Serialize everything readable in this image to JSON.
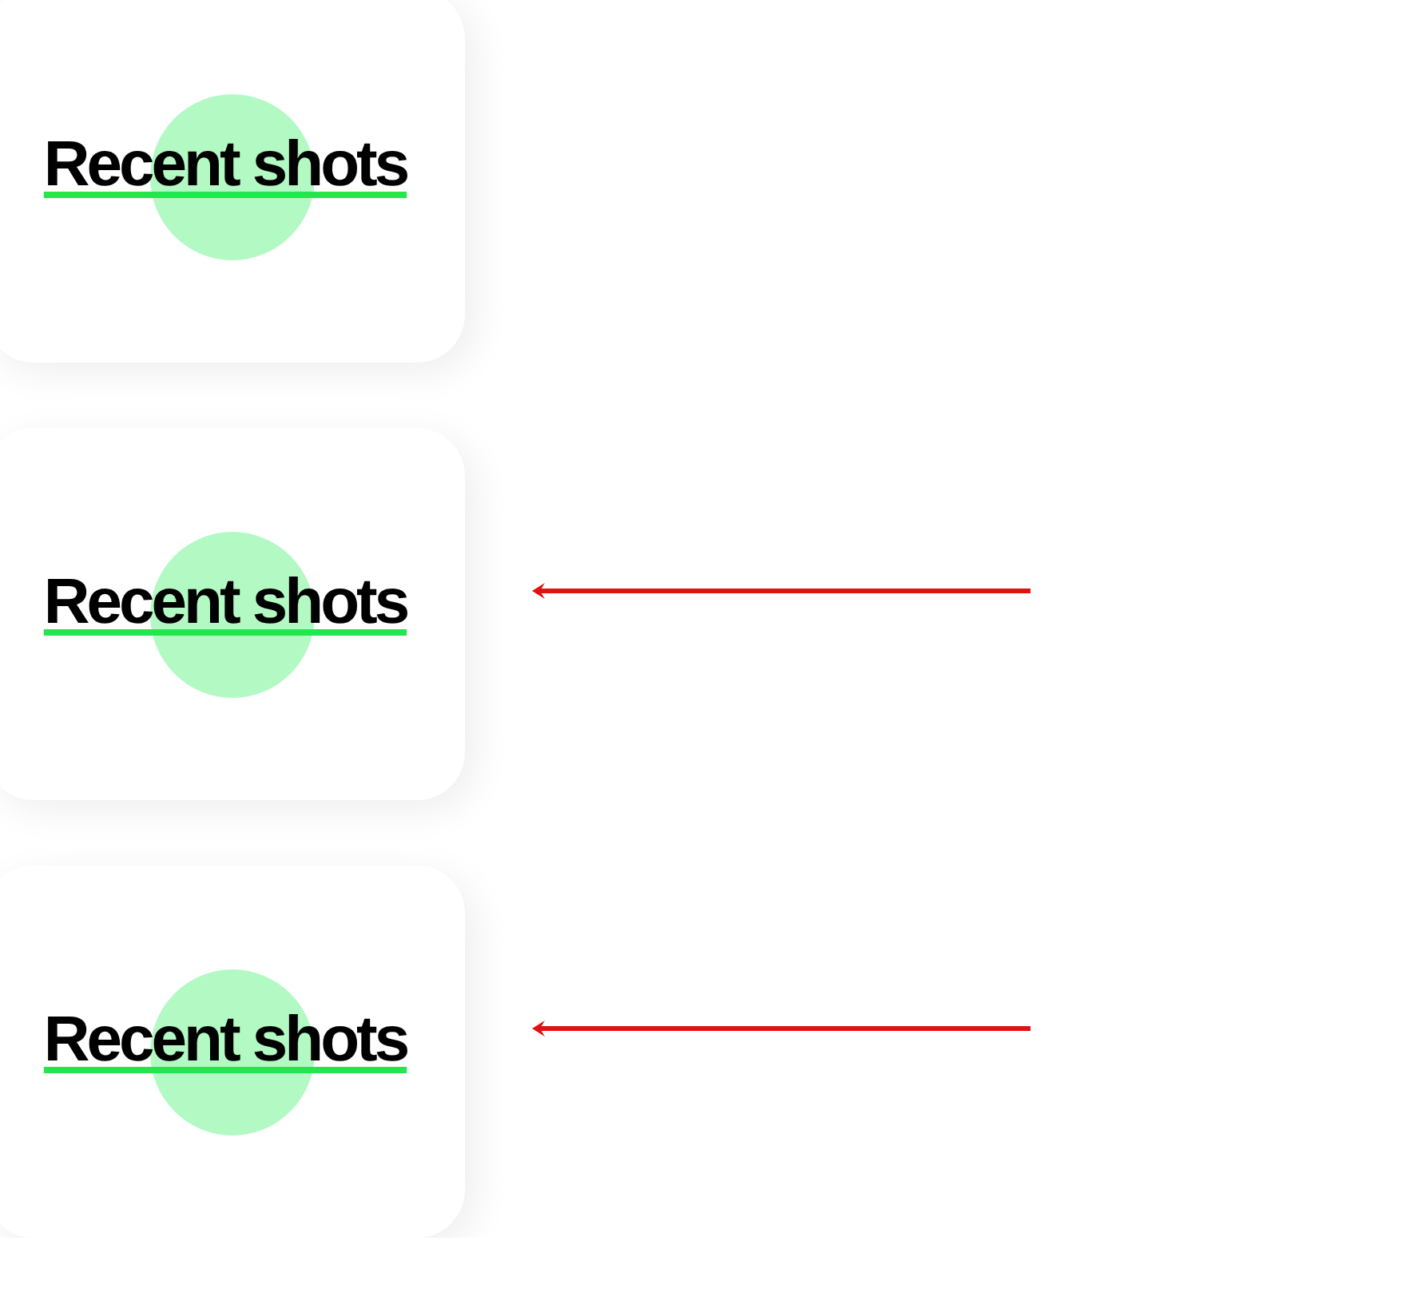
{
  "cards": [
    {
      "title": "Recent shots",
      "arrow": false
    },
    {
      "title": "Recent shots",
      "arrow": true
    },
    {
      "title": "Recent shots",
      "arrow": true
    }
  ]
}
